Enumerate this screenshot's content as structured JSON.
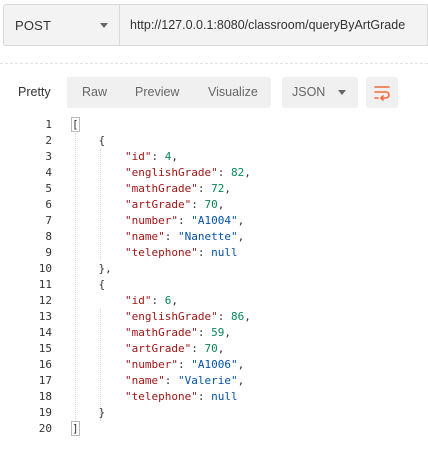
{
  "request": {
    "method": "POST",
    "url": "http://127.0.0.1:8080/classroom/queryByArtGrade"
  },
  "response_toolbar": {
    "tabs": [
      "Pretty",
      "Raw",
      "Preview",
      "Visualize"
    ],
    "active_tab": "Pretty",
    "format": "JSON",
    "wrap_icon": "wrap-lines-icon",
    "accent_color": "#f26b3a"
  },
  "code": {
    "line_numbers": [
      "1",
      "2",
      "3",
      "4",
      "5",
      "6",
      "7",
      "8",
      "9",
      "10",
      "11",
      "12",
      "13",
      "14",
      "15",
      "16",
      "17",
      "18",
      "19",
      "20"
    ],
    "lines": [
      [
        {
          "t": "[",
          "c": "punct"
        }
      ],
      [
        {
          "t": "    {",
          "c": "punct"
        }
      ],
      [
        {
          "t": "        ",
          "c": "punct"
        },
        {
          "t": "\"id\"",
          "c": "key"
        },
        {
          "t": ": ",
          "c": "punct"
        },
        {
          "t": "4",
          "c": "num"
        },
        {
          "t": ",",
          "c": "punct"
        }
      ],
      [
        {
          "t": "        ",
          "c": "punct"
        },
        {
          "t": "\"englishGrade\"",
          "c": "key"
        },
        {
          "t": ": ",
          "c": "punct"
        },
        {
          "t": "82",
          "c": "num"
        },
        {
          "t": ",",
          "c": "punct"
        }
      ],
      [
        {
          "t": "        ",
          "c": "punct"
        },
        {
          "t": "\"mathGrade\"",
          "c": "key"
        },
        {
          "t": ": ",
          "c": "punct"
        },
        {
          "t": "72",
          "c": "num"
        },
        {
          "t": ",",
          "c": "punct"
        }
      ],
      [
        {
          "t": "        ",
          "c": "punct"
        },
        {
          "t": "\"artGrade\"",
          "c": "key"
        },
        {
          "t": ": ",
          "c": "punct"
        },
        {
          "t": "70",
          "c": "num"
        },
        {
          "t": ",",
          "c": "punct"
        }
      ],
      [
        {
          "t": "        ",
          "c": "punct"
        },
        {
          "t": "\"number\"",
          "c": "key"
        },
        {
          "t": ": ",
          "c": "punct"
        },
        {
          "t": "\"A1004\"",
          "c": "str"
        },
        {
          "t": ",",
          "c": "punct"
        }
      ],
      [
        {
          "t": "        ",
          "c": "punct"
        },
        {
          "t": "\"name\"",
          "c": "key"
        },
        {
          "t": ": ",
          "c": "punct"
        },
        {
          "t": "\"Nanette\"",
          "c": "str"
        },
        {
          "t": ",",
          "c": "punct"
        }
      ],
      [
        {
          "t": "        ",
          "c": "punct"
        },
        {
          "t": "\"telephone\"",
          "c": "key"
        },
        {
          "t": ": ",
          "c": "punct"
        },
        {
          "t": "null",
          "c": "kw"
        }
      ],
      [
        {
          "t": "    },",
          "c": "punct"
        }
      ],
      [
        {
          "t": "    {",
          "c": "punct"
        }
      ],
      [
        {
          "t": "        ",
          "c": "punct"
        },
        {
          "t": "\"id\"",
          "c": "key"
        },
        {
          "t": ": ",
          "c": "punct"
        },
        {
          "t": "6",
          "c": "num"
        },
        {
          "t": ",",
          "c": "punct"
        }
      ],
      [
        {
          "t": "        ",
          "c": "punct"
        },
        {
          "t": "\"englishGrade\"",
          "c": "key"
        },
        {
          "t": ": ",
          "c": "punct"
        },
        {
          "t": "86",
          "c": "num"
        },
        {
          "t": ",",
          "c": "punct"
        }
      ],
      [
        {
          "t": "        ",
          "c": "punct"
        },
        {
          "t": "\"mathGrade\"",
          "c": "key"
        },
        {
          "t": ": ",
          "c": "punct"
        },
        {
          "t": "59",
          "c": "num"
        },
        {
          "t": ",",
          "c": "punct"
        }
      ],
      [
        {
          "t": "        ",
          "c": "punct"
        },
        {
          "t": "\"artGrade\"",
          "c": "key"
        },
        {
          "t": ": ",
          "c": "punct"
        },
        {
          "t": "70",
          "c": "num"
        },
        {
          "t": ",",
          "c": "punct"
        }
      ],
      [
        {
          "t": "        ",
          "c": "punct"
        },
        {
          "t": "\"number\"",
          "c": "key"
        },
        {
          "t": ": ",
          "c": "punct"
        },
        {
          "t": "\"A1006\"",
          "c": "str"
        },
        {
          "t": ",",
          "c": "punct"
        }
      ],
      [
        {
          "t": "        ",
          "c": "punct"
        },
        {
          "t": "\"name\"",
          "c": "key"
        },
        {
          "t": ": ",
          "c": "punct"
        },
        {
          "t": "\"Valerie\"",
          "c": "str"
        },
        {
          "t": ",",
          "c": "punct"
        }
      ],
      [
        {
          "t": "        ",
          "c": "punct"
        },
        {
          "t": "\"telephone\"",
          "c": "key"
        },
        {
          "t": ": ",
          "c": "punct"
        },
        {
          "t": "null",
          "c": "kw"
        }
      ],
      [
        {
          "t": "    }",
          "c": "punct"
        }
      ],
      [
        {
          "t": "]",
          "c": "punct"
        }
      ]
    ]
  }
}
